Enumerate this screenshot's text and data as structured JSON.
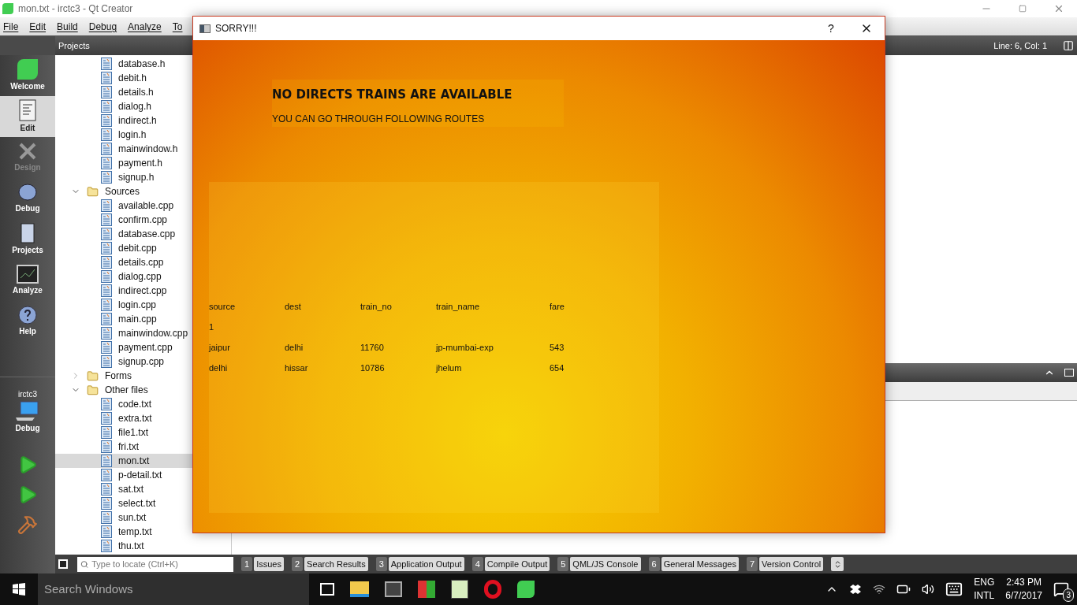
{
  "window": {
    "title": "mon.txt - irctc3 - Qt Creator"
  },
  "menu": [
    "File",
    "Edit",
    "Build",
    "Debug",
    "Analyze",
    "To"
  ],
  "projects_bar": {
    "title": "Projects"
  },
  "modes": [
    {
      "label": "Welcome",
      "selected": false,
      "disabled": false
    },
    {
      "label": "Edit",
      "selected": true,
      "disabled": false
    },
    {
      "label": "Design",
      "selected": false,
      "disabled": true
    },
    {
      "label": "Debug",
      "selected": false,
      "disabled": false
    },
    {
      "label": "Projects",
      "selected": false,
      "disabled": false
    },
    {
      "label": "Analyze",
      "selected": false,
      "disabled": false
    },
    {
      "label": "Help",
      "selected": false,
      "disabled": false
    }
  ],
  "kit": {
    "project": "irctc3",
    "config": "Debug"
  },
  "tree": [
    {
      "kind": "file",
      "label": "database.h",
      "selected": false
    },
    {
      "kind": "file",
      "label": "debit.h",
      "selected": false
    },
    {
      "kind": "file",
      "label": "details.h",
      "selected": false
    },
    {
      "kind": "file",
      "label": "dialog.h",
      "selected": false
    },
    {
      "kind": "file",
      "label": "indirect.h",
      "selected": false
    },
    {
      "kind": "file",
      "label": "login.h",
      "selected": false
    },
    {
      "kind": "file",
      "label": "mainwindow.h",
      "selected": false
    },
    {
      "kind": "file",
      "label": "payment.h",
      "selected": false
    },
    {
      "kind": "file",
      "label": "signup.h",
      "selected": false
    },
    {
      "kind": "folder",
      "label": "Sources",
      "expanded": true,
      "children": [
        {
          "kind": "file",
          "label": "available.cpp",
          "selected": false
        },
        {
          "kind": "file",
          "label": "confirm.cpp",
          "selected": false
        },
        {
          "kind": "file",
          "label": "database.cpp",
          "selected": false
        },
        {
          "kind": "file",
          "label": "debit.cpp",
          "selected": false
        },
        {
          "kind": "file",
          "label": "details.cpp",
          "selected": false
        },
        {
          "kind": "file",
          "label": "dialog.cpp",
          "selected": false
        },
        {
          "kind": "file",
          "label": "indirect.cpp",
          "selected": false
        },
        {
          "kind": "file",
          "label": "login.cpp",
          "selected": false
        },
        {
          "kind": "file",
          "label": "main.cpp",
          "selected": false
        },
        {
          "kind": "file",
          "label": "mainwindow.cpp",
          "selected": false
        },
        {
          "kind": "file",
          "label": "payment.cpp",
          "selected": false
        },
        {
          "kind": "file",
          "label": "signup.cpp",
          "selected": false
        }
      ]
    },
    {
      "kind": "folder",
      "label": "Forms",
      "expanded": false
    },
    {
      "kind": "folder",
      "label": "Other files",
      "expanded": true,
      "children": [
        {
          "kind": "file",
          "label": "code.txt",
          "selected": false
        },
        {
          "kind": "file",
          "label": "extra.txt",
          "selected": false
        },
        {
          "kind": "file",
          "label": "file1.txt",
          "selected": false
        },
        {
          "kind": "file",
          "label": "fri.txt",
          "selected": false
        },
        {
          "kind": "file",
          "label": "mon.txt",
          "selected": true
        },
        {
          "kind": "file",
          "label": "p-detail.txt",
          "selected": false
        },
        {
          "kind": "file",
          "label": "sat.txt",
          "selected": false
        },
        {
          "kind": "file",
          "label": "select.txt",
          "selected": false
        },
        {
          "kind": "file",
          "label": "sun.txt",
          "selected": false
        },
        {
          "kind": "file",
          "label": "temp.txt",
          "selected": false
        },
        {
          "kind": "file",
          "label": "thu.txt",
          "selected": false
        }
      ]
    }
  ],
  "editor": {
    "position": "Line: 6, Col: 1"
  },
  "locator": {
    "placeholder": "Type to locate (Ctrl+K)"
  },
  "output_tabs": [
    {
      "number": "1",
      "label": "Issues"
    },
    {
      "number": "2",
      "label": "Search Results"
    },
    {
      "number": "3",
      "label": "Application Output"
    },
    {
      "number": "4",
      "label": "Compile Output"
    },
    {
      "number": "5",
      "label": "QML/JS Console"
    },
    {
      "number": "6",
      "label": "General Messages"
    },
    {
      "number": "7",
      "label": "Version Control"
    }
  ],
  "dialog": {
    "title": "SORRY!!!",
    "help": "?",
    "heading": "NO DIRECTS TRAINS ARE AVAILABLE",
    "subheading": "YOU CAN GO THROUGH FOLLOWING ROUTES",
    "columns": [
      "source",
      "dest",
      "train_no",
      "train_name",
      "fare"
    ],
    "rows": [
      [
        "1"
      ],
      [
        "jaipur",
        "delhi",
        "11760",
        "jp-mumbai-exp",
        "543"
      ],
      [
        "delhi",
        "hissar",
        "10786",
        "jhelum",
        "654"
      ]
    ]
  },
  "taskbar": {
    "search": "Search Windows",
    "language": "ENG",
    "layout": "INTL",
    "time": "2:43 PM",
    "date": "6/7/2017",
    "notifications": "3"
  }
}
